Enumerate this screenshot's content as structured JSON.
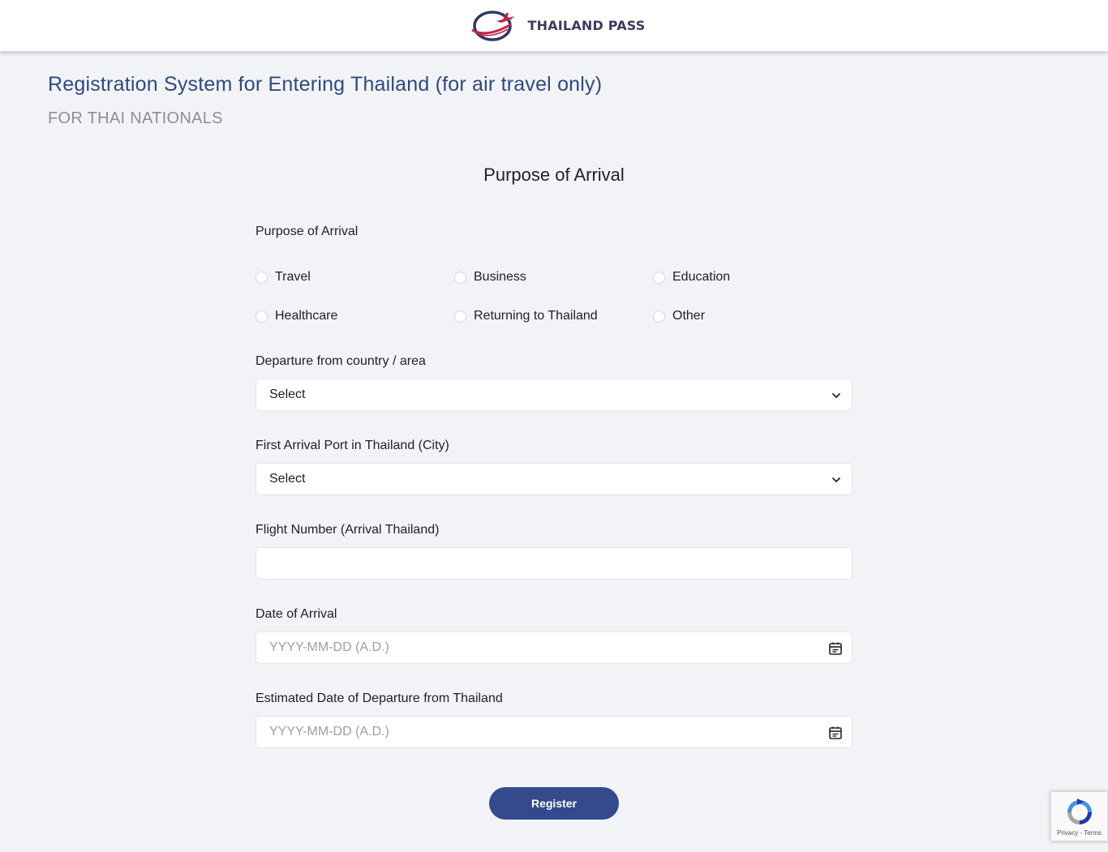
{
  "header": {
    "brand_name": "THAILAND PASS",
    "logo_icon": "thailand-pass-plane-logo",
    "bg_color": "#ffffff"
  },
  "page": {
    "title": "Registration System for Entering Thailand (for air travel only)",
    "subtitle": "FOR THAI NATIONALS",
    "title_color": "#2f4a80"
  },
  "section": {
    "title": "Purpose of Arrival"
  },
  "form": {
    "purpose": {
      "label": "Purpose of Arrival",
      "options": [
        "Travel",
        "Business",
        "Education",
        "Healthcare",
        "Returning to Thailand",
        "Other"
      ],
      "selected": null
    },
    "departure_country": {
      "label": "Departure from country / area",
      "value": "Select"
    },
    "arrival_port": {
      "label": "First Arrival Port in Thailand (City)",
      "value": "Select"
    },
    "flight_number": {
      "label": "Flight Number (Arrival Thailand)",
      "value": ""
    },
    "arrival_date": {
      "label": "Date of Arrival",
      "placeholder": "YYYY-MM-DD (A.D.)"
    },
    "departure_date": {
      "label": "Estimated Date of Departure from Thailand",
      "placeholder": "YYYY-MM-DD (A.D.)"
    },
    "submit_label": "Register",
    "submit_color": "#344a8c"
  },
  "recaptcha": {
    "links": "Privacy - Terms",
    "icon": "recaptcha-icon"
  }
}
